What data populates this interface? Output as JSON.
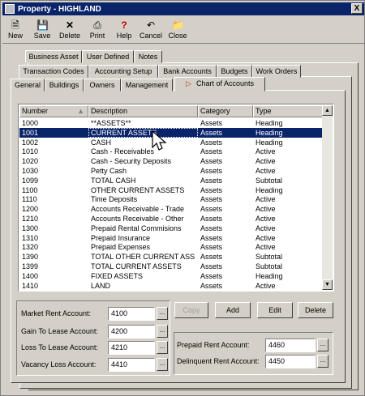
{
  "window": {
    "title": "Property - HIGHLAND",
    "close_glyph": "X"
  },
  "toolbar": {
    "new": "New",
    "save": "Save",
    "delete": "Delete",
    "print": "Print",
    "help": "Help",
    "cancel": "Cancel",
    "close": "Close"
  },
  "tabs": {
    "row1": [
      "Business Asset",
      "User Defined",
      "Notes"
    ],
    "row2": [
      "Transaction Codes",
      "Accounting Setup",
      "Bank Accounts",
      "Budgets",
      "Work Orders"
    ],
    "row3": [
      "General",
      "Buildings",
      "Owners",
      "Management",
      "Chart of Accounts"
    ]
  },
  "grid": {
    "columns": [
      "Number",
      "Description",
      "Category",
      "Type"
    ],
    "rows": [
      [
        "1000",
        "**ASSETS**",
        "Assets",
        "Heading"
      ],
      [
        "1001",
        "CURRENT ASSETS",
        "Assets",
        "Heading"
      ],
      [
        "1002",
        "CASH",
        "Assets",
        "Heading"
      ],
      [
        "1010",
        "Cash - Receivables",
        "Assets",
        "Active"
      ],
      [
        "1020",
        "Cash - Security Deposits",
        "Assets",
        "Active"
      ],
      [
        "1030",
        "Petty Cash",
        "Assets",
        "Active"
      ],
      [
        "1099",
        "TOTAL CASH",
        "Assets",
        "Subtotal"
      ],
      [
        "1100",
        "OTHER CURRENT ASSETS",
        "Assets",
        "Heading"
      ],
      [
        "1110",
        "Time Deposits",
        "Assets",
        "Active"
      ],
      [
        "1200",
        "Accounts Receivable - Trade",
        "Assets",
        "Active"
      ],
      [
        "1210",
        "Accounts Receivable - Other",
        "Assets",
        "Active"
      ],
      [
        "1300",
        "Prepaid Rental Commisions",
        "Assets",
        "Active"
      ],
      [
        "1310",
        "Prepaid Insurance",
        "Assets",
        "Active"
      ],
      [
        "1320",
        "Prepaid Expenses",
        "Assets",
        "Active"
      ],
      [
        "1390",
        "TOTAL OTHER CURRENT ASS",
        "Assets",
        "Subtotal"
      ],
      [
        "1399",
        "TOTAL CURRENT ASSETS",
        "Assets",
        "Subtotal"
      ],
      [
        "1400",
        "FIXED ASSETS",
        "Assets",
        "Heading"
      ],
      [
        "1410",
        "LAND",
        "Assets",
        "Active"
      ]
    ],
    "selected_index": 1
  },
  "actions": {
    "copy": "Copy",
    "add": "Add",
    "edit": "Edit",
    "remove": "Delete"
  },
  "accounts": {
    "market_rent_label": "Market Rent Account:",
    "market_rent_value": "4100",
    "gain_to_lease_label": "Gain To Lease Account:",
    "gain_to_lease_value": "4200",
    "loss_to_lease_label": "Loss To Lease Account:",
    "loss_to_lease_value": "4210",
    "vacancy_loss_label": "Vacancy Loss Account:",
    "vacancy_loss_value": "4410",
    "prepaid_rent_label": "Prepaid Rent Account:",
    "prepaid_rent_value": "4460",
    "delinquent_rent_label": "Delinquent Rent Account:",
    "delinquent_rent_value": "4450",
    "ellipsis": "..."
  },
  "colors": {
    "titlebar": "#0a246a",
    "selection": "#0a246a",
    "face": "#d4d0c8"
  }
}
